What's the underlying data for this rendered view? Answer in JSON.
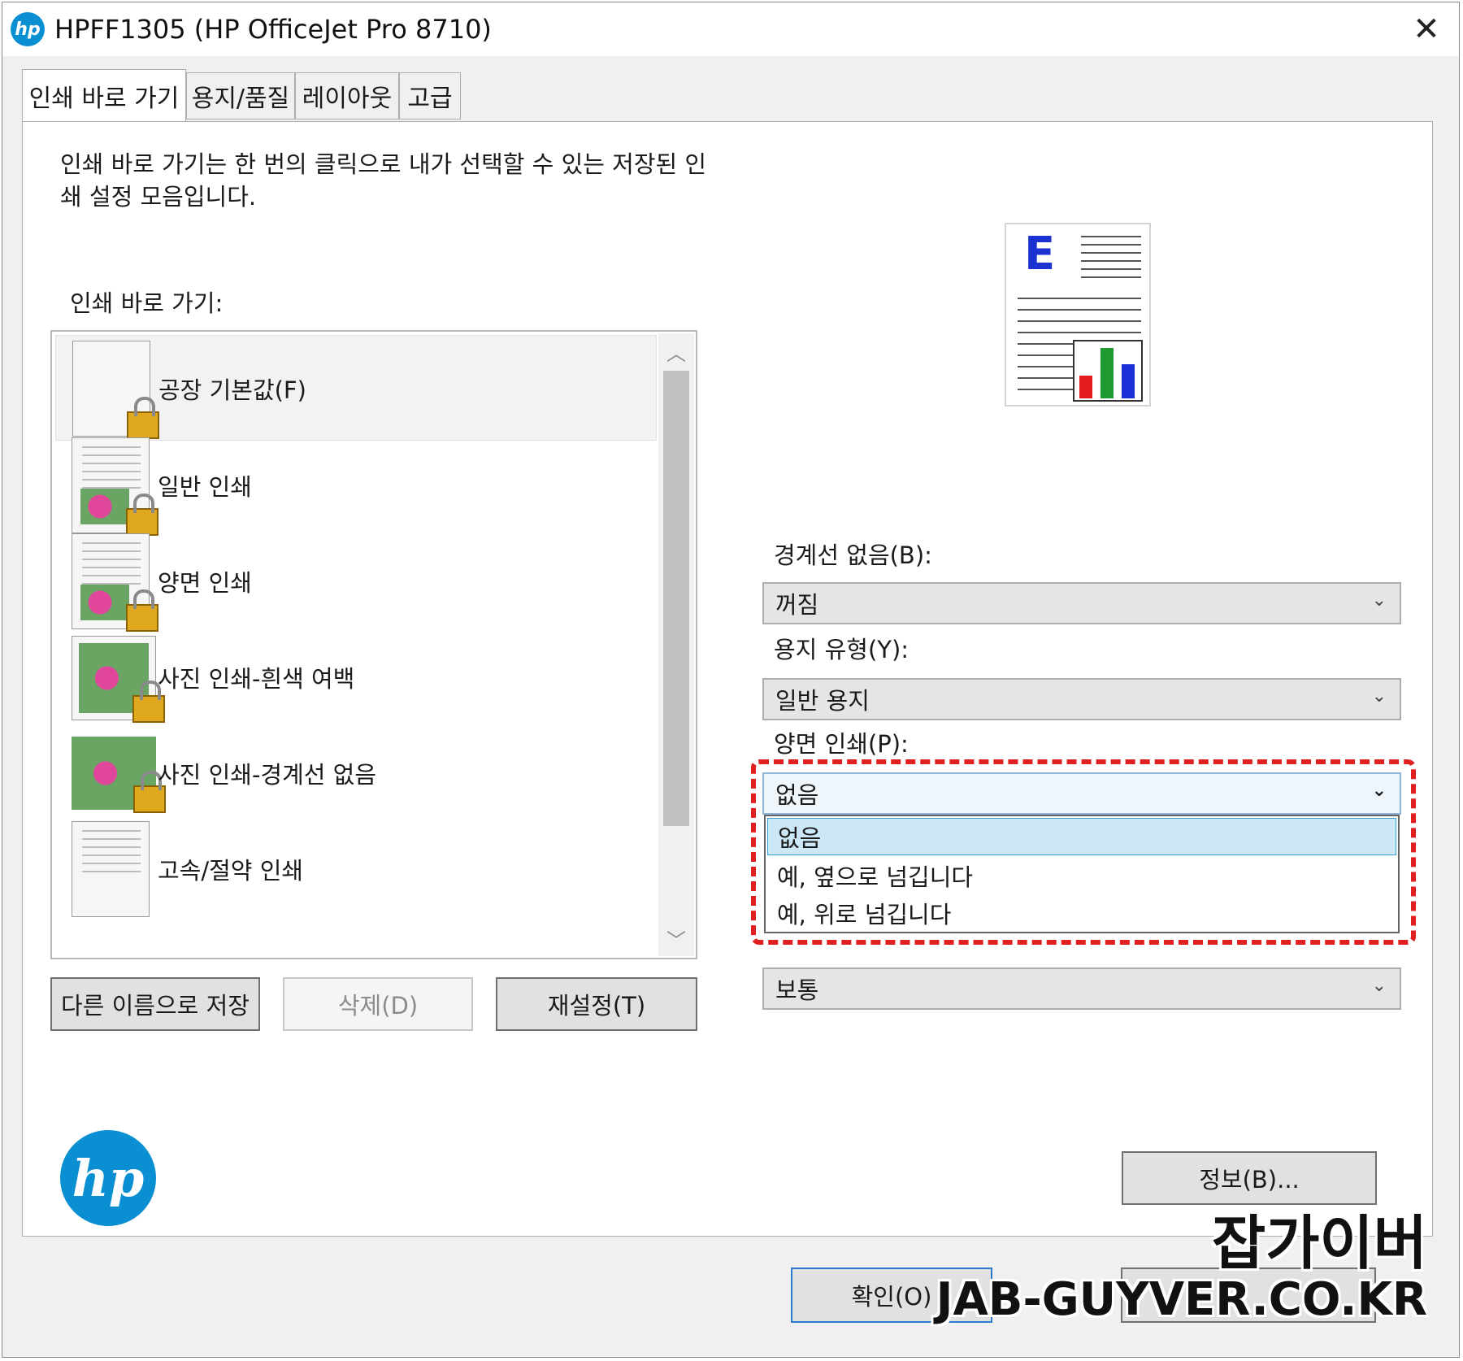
{
  "window": {
    "title": "HPFF1305 (HP OfficeJet Pro 8710)",
    "logo_text": "hp",
    "close_glyph": "✕"
  },
  "tabs": [
    {
      "label": "인쇄 바로 가기",
      "active": true
    },
    {
      "label": "용지/품질",
      "active": false
    },
    {
      "label": "레이아웃",
      "active": false
    },
    {
      "label": "고급",
      "active": false
    }
  ],
  "description": "인쇄 바로 가기는 한 번의 클릭으로 내가 선택할 수 있는 저장된 인쇄 설정 모음입니다.",
  "shortcuts": {
    "label": "인쇄 바로 가기:",
    "items": [
      {
        "label": "공장 기본값(F)",
        "selected": true,
        "icon": "blank-page-lock-icon"
      },
      {
        "label": "일반 인쇄",
        "selected": false,
        "icon": "text-photo-lock-icon"
      },
      {
        "label": "양면 인쇄",
        "selected": false,
        "icon": "duplex-lock-icon"
      },
      {
        "label": "사진 인쇄-흰색 여백",
        "selected": false,
        "icon": "photo-border-lock-icon"
      },
      {
        "label": "사진 인쇄-경계선 없음",
        "selected": false,
        "icon": "photo-borderless-lock-icon"
      },
      {
        "label": "고속/절약 인쇄",
        "selected": false,
        "icon": "draft-lock-icon"
      }
    ],
    "scroll_up": "︿",
    "scroll_down": "﹀"
  },
  "buttons": {
    "save_as": "다른 이름으로 저장",
    "delete": "삭제(D)",
    "reset": "재설정(T)",
    "info": "정보(B)...",
    "ok": "확인(O)"
  },
  "preview": {
    "letter": "E",
    "bar_colors": [
      "#e21b1b",
      "#1f9a2f",
      "#1b2fd6"
    ]
  },
  "settings": {
    "borderless": {
      "label": "경계선 없음(B):",
      "value": "꺼짐"
    },
    "paper_type": {
      "label": "용지 유형(Y):",
      "value": "일반 용지"
    },
    "duplex": {
      "label": "양면 인쇄(P):",
      "value": "없음",
      "options": [
        "없음",
        "예, 옆으로 넘깁니다",
        "예, 위로 넘깁니다"
      ]
    },
    "quality": {
      "value": "보통"
    }
  },
  "chevron_glyph": "⌄",
  "accent_color": "#e02020",
  "watermark": {
    "korean": "잡가이버",
    "english": "JAB-GUYVER.CO.KR"
  }
}
